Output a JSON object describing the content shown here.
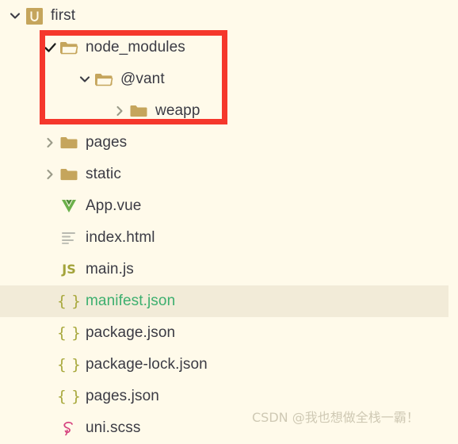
{
  "explorer": {
    "background_color": "#fffaea",
    "selected_row_color": "#f2ebd8",
    "text_color": "#3b3b44",
    "modified_color": "#3daf6f",
    "folder_color": "#c5a55c",
    "chevron_color": "#8c8c7e",
    "rows": [
      {
        "label": "first",
        "indent": 0,
        "twisty": "chevron-down-icon",
        "icon": "uniapp-project-icon",
        "selected": false,
        "modified": false
      },
      {
        "label": "node_modules",
        "indent": 1,
        "twisty": "check-icon",
        "icon": "folder-open-icon",
        "selected": false,
        "modified": false
      },
      {
        "label": "@vant",
        "indent": 2,
        "twisty": "chevron-down-icon",
        "icon": "folder-open-icon",
        "selected": false,
        "modified": false
      },
      {
        "label": "weapp",
        "indent": 3,
        "twisty": "chevron-right-icon",
        "icon": "folder-closed-icon",
        "selected": false,
        "modified": false
      },
      {
        "label": "pages",
        "indent": 1,
        "twisty": "chevron-right-icon",
        "icon": "folder-closed-icon",
        "selected": false,
        "modified": false
      },
      {
        "label": "static",
        "indent": 1,
        "twisty": "chevron-right-icon",
        "icon": "folder-closed-icon",
        "selected": false,
        "modified": false
      },
      {
        "label": "App.vue",
        "indent": 1,
        "twisty": "none",
        "icon": "vue-file-icon",
        "selected": false,
        "modified": false
      },
      {
        "label": "index.html",
        "indent": 1,
        "twisty": "none",
        "icon": "html-file-icon",
        "selected": false,
        "modified": false
      },
      {
        "label": "main.js",
        "indent": 1,
        "twisty": "none",
        "icon": "js-file-icon",
        "selected": false,
        "modified": false
      },
      {
        "label": "manifest.json",
        "indent": 1,
        "twisty": "none",
        "icon": "json-file-icon",
        "selected": true,
        "modified": true
      },
      {
        "label": "package.json",
        "indent": 1,
        "twisty": "none",
        "icon": "json-file-icon",
        "selected": false,
        "modified": false
      },
      {
        "label": "package-lock.json",
        "indent": 1,
        "twisty": "none",
        "icon": "json-file-icon",
        "selected": false,
        "modified": false
      },
      {
        "label": "pages.json",
        "indent": 1,
        "twisty": "none",
        "icon": "json-file-icon",
        "selected": false,
        "modified": false
      },
      {
        "label": "uni.scss",
        "indent": 1,
        "twisty": "none",
        "icon": "scss-file-icon",
        "selected": false,
        "modified": false
      }
    ]
  },
  "annotation": {
    "highlight_box_color": "#f5372c",
    "name": "red-highlight-box"
  },
  "watermark": {
    "text": "CSDN @我也想做全栈一霸！",
    "color": "#cfc9b4"
  }
}
